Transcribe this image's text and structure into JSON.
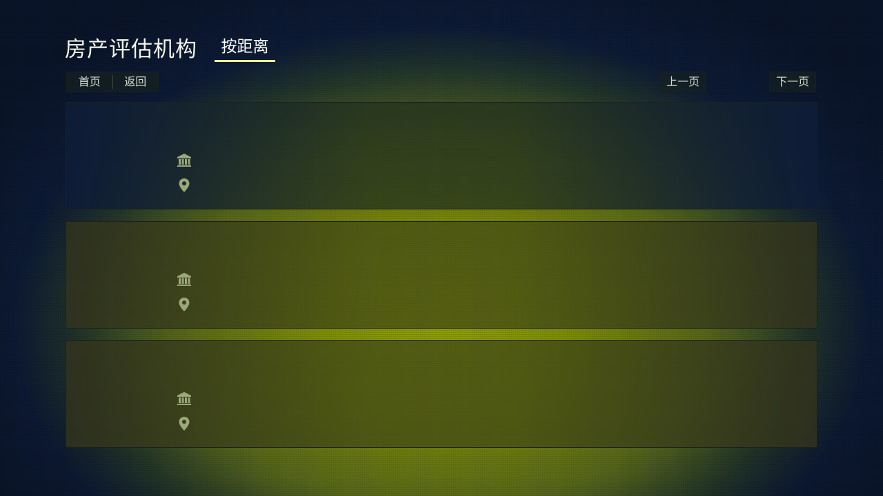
{
  "header": {
    "title": "房产评估机构",
    "sort_tab_label": "按距离"
  },
  "nav": {
    "home_label": "首页",
    "back_label": "返回",
    "prev_label": "上一页",
    "next_label": "下一页"
  },
  "cards": [
    {
      "name": "",
      "address": "",
      "icons": [
        "bank-icon",
        "location-pin-icon"
      ]
    },
    {
      "name": "",
      "address": "",
      "icons": [
        "bank-icon",
        "location-pin-icon"
      ]
    },
    {
      "name": "",
      "address": "",
      "icons": [
        "bank-icon",
        "location-pin-icon"
      ]
    }
  ],
  "colors": {
    "accent_underline": "#f0f29a",
    "icon": "#9aa87a"
  }
}
